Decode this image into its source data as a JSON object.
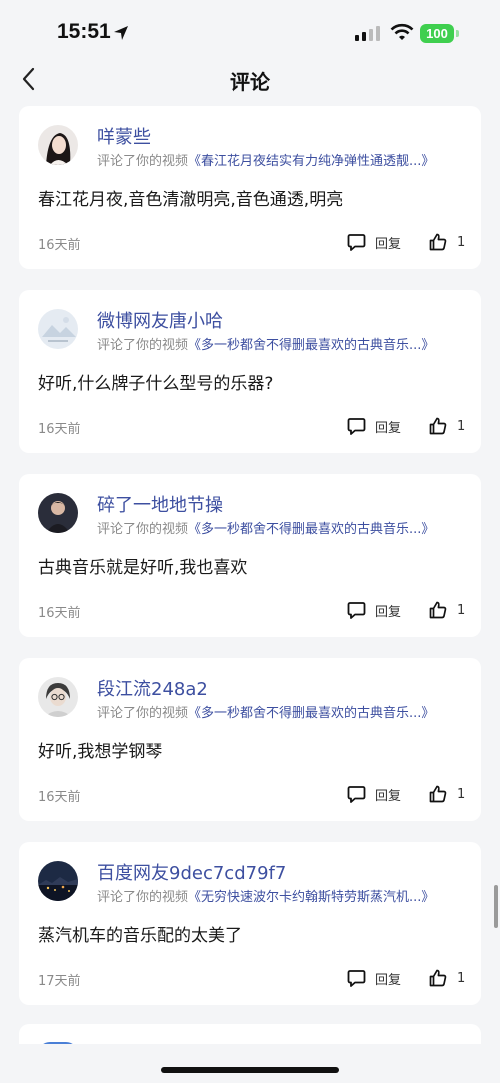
{
  "status_bar": {
    "time": "15:51",
    "battery": "100"
  },
  "nav": {
    "title": "评论"
  },
  "comments": [
    {
      "username": "咩蒙些",
      "action": "评论了你的视频",
      "video_title": "《春江花月夜结实有力纯净弹性通透靓...》",
      "text": "春江花月夜,音色清澈明亮,音色通透,明亮",
      "time": "16天前",
      "reply_label": "回复",
      "likes": "1"
    },
    {
      "username": "微博网友唐小哈",
      "action": "评论了你的视频",
      "video_title": "《多一秒都舍不得删最喜欢的古典音乐...》",
      "text": "好听,什么牌子什么型号的乐器?",
      "time": "16天前",
      "reply_label": "回复",
      "likes": "1"
    },
    {
      "username": "碎了一地地节操",
      "action": "评论了你的视频",
      "video_title": "《多一秒都舍不得删最喜欢的古典音乐...》",
      "text": "古典音乐就是好听,我也喜欢",
      "time": "16天前",
      "reply_label": "回复",
      "likes": "1"
    },
    {
      "username": "段江流248a2",
      "action": "评论了你的视频",
      "video_title": "《多一秒都舍不得删最喜欢的古典音乐...》",
      "text": "好听,我想学钢琴",
      "time": "16天前",
      "reply_label": "回复",
      "likes": "1"
    },
    {
      "username": "百度网友9dec7cd79f7",
      "action": "评论了你的视频",
      "video_title": "《无穷快速波尔卡约翰斯特劳斯蒸汽机...》",
      "text": "蒸汽机车的音乐配的太美了",
      "time": "17天前",
      "reply_label": "回复",
      "likes": "1"
    }
  ]
}
